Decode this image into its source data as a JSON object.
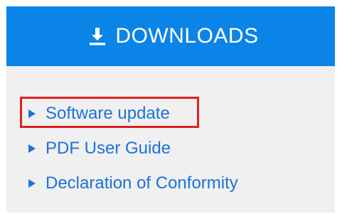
{
  "header": {
    "title": "DOWNLOADS",
    "icon": "download-icon",
    "background_color": "#0b84e8"
  },
  "links": [
    {
      "label": "Software update",
      "icon": "triangle-right-icon",
      "highlighted": true
    },
    {
      "label": "PDF User Guide",
      "icon": "triangle-right-icon",
      "highlighted": false
    },
    {
      "label": "Declaration of Conformity",
      "icon": "triangle-right-icon",
      "highlighted": false
    }
  ],
  "colors": {
    "link": "#1a73d9",
    "highlight_border": "#e02020",
    "panel_background": "#f0f0f0"
  }
}
